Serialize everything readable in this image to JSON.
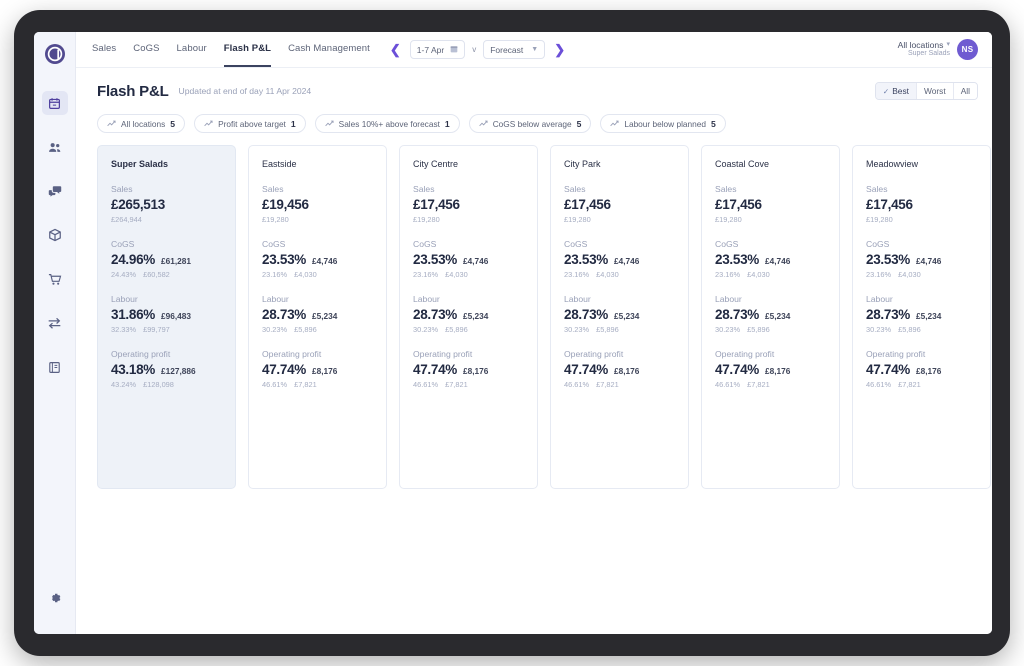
{
  "sidebar": {
    "logo_icon": "location-pin-logo",
    "items": [
      {
        "name": "calendar",
        "icon": "calendar-icon",
        "active": true
      },
      {
        "name": "people",
        "icon": "people-icon",
        "active": false
      },
      {
        "name": "chat",
        "icon": "chat-icon",
        "active": false
      },
      {
        "name": "inventory",
        "icon": "box-icon",
        "active": false
      },
      {
        "name": "orders",
        "icon": "cart-icon",
        "active": false
      },
      {
        "name": "transfers",
        "icon": "transfer-arrows-icon",
        "active": false
      },
      {
        "name": "reports",
        "icon": "book-icon",
        "active": false
      }
    ],
    "settings_icon": "gear-icon"
  },
  "topnav": {
    "tabs": [
      {
        "label": "Sales",
        "active": false
      },
      {
        "label": "CoGS",
        "active": false
      },
      {
        "label": "Labour",
        "active": false
      },
      {
        "label": "Flash P&L",
        "active": true
      },
      {
        "label": "Cash Management",
        "active": false
      }
    ],
    "prev_icon": "chevron-left-icon",
    "next_icon": "chevron-right-icon",
    "date_value": "1-7 Apr",
    "date_icon": "calendar-icon",
    "vs_label": "v",
    "compare_value": "Forecast",
    "location_label": "All locations",
    "company_label": "Super Salads",
    "avatar_initials": "NS"
  },
  "page": {
    "title": "Flash P&L",
    "subtitle": "Updated at end of day 11 Apr 2024",
    "segmented": [
      {
        "label": "Best",
        "selected": true
      },
      {
        "label": "Worst",
        "selected": false
      },
      {
        "label": "All",
        "selected": false
      }
    ]
  },
  "chips": [
    {
      "label": "All locations",
      "count": "5",
      "icon": "trend-icon"
    },
    {
      "label": "Profit above target",
      "count": "1",
      "icon": "trend-icon"
    },
    {
      "label": "Sales 10%+ above forecast",
      "count": "1",
      "icon": "trend-icon"
    },
    {
      "label": "CoGS below average",
      "count": "5",
      "icon": "trend-icon"
    },
    {
      "label": "Labour below planned",
      "count": "5",
      "icon": "trend-icon"
    }
  ],
  "metric_labels": {
    "sales": "Sales",
    "cogs": "CoGS",
    "labour": "Labour",
    "operating_profit": "Operating profit"
  },
  "cards": [
    {
      "name": "Super Salads",
      "highlighted": true,
      "sales": {
        "main": "£265,513",
        "prev": "£264,944"
      },
      "cogs": {
        "pct": "24.96%",
        "amt": "£61,281",
        "prev_pct": "24.43%",
        "prev_amt": "£60,582"
      },
      "labour": {
        "pct": "31.86%",
        "amt": "£96,483",
        "prev_pct": "32.33%",
        "prev_amt": "£99,797"
      },
      "op": {
        "pct": "43.18%",
        "amt": "£127,886",
        "prev_pct": "43.24%",
        "prev_amt": "£128,098"
      }
    },
    {
      "name": "Eastside",
      "highlighted": false,
      "sales": {
        "main": "£19,456",
        "prev": "£19,280"
      },
      "cogs": {
        "pct": "23.53%",
        "amt": "£4,746",
        "prev_pct": "23.16%",
        "prev_amt": "£4,030"
      },
      "labour": {
        "pct": "28.73%",
        "amt": "£5,234",
        "prev_pct": "30.23%",
        "prev_amt": "£5,896"
      },
      "op": {
        "pct": "47.74%",
        "amt": "£8,176",
        "prev_pct": "46.61%",
        "prev_amt": "£7,821"
      }
    },
    {
      "name": "City Centre",
      "highlighted": false,
      "sales": {
        "main": "£17,456",
        "prev": "£19,280"
      },
      "cogs": {
        "pct": "23.53%",
        "amt": "£4,746",
        "prev_pct": "23.16%",
        "prev_amt": "£4,030"
      },
      "labour": {
        "pct": "28.73%",
        "amt": "£5,234",
        "prev_pct": "30.23%",
        "prev_amt": "£5,896"
      },
      "op": {
        "pct": "47.74%",
        "amt": "£8,176",
        "prev_pct": "46.61%",
        "prev_amt": "£7,821"
      }
    },
    {
      "name": "City Park",
      "highlighted": false,
      "sales": {
        "main": "£17,456",
        "prev": "£19,280"
      },
      "cogs": {
        "pct": "23.53%",
        "amt": "£4,746",
        "prev_pct": "23.16%",
        "prev_amt": "£4,030"
      },
      "labour": {
        "pct": "28.73%",
        "amt": "£5,234",
        "prev_pct": "30.23%",
        "prev_amt": "£5,896"
      },
      "op": {
        "pct": "47.74%",
        "amt": "£8,176",
        "prev_pct": "46.61%",
        "prev_amt": "£7,821"
      }
    },
    {
      "name": "Coastal Cove",
      "highlighted": false,
      "sales": {
        "main": "£17,456",
        "prev": "£19,280"
      },
      "cogs": {
        "pct": "23.53%",
        "amt": "£4,746",
        "prev_pct": "23.16%",
        "prev_amt": "£4,030"
      },
      "labour": {
        "pct": "28.73%",
        "amt": "£5,234",
        "prev_pct": "30.23%",
        "prev_amt": "£5,896"
      },
      "op": {
        "pct": "47.74%",
        "amt": "£8,176",
        "prev_pct": "46.61%",
        "prev_amt": "£7,821"
      }
    },
    {
      "name": "Meadowview",
      "highlighted": false,
      "sales": {
        "main": "£17,456",
        "prev": "£19,280"
      },
      "cogs": {
        "pct": "23.53%",
        "amt": "£4,746",
        "prev_pct": "23.16%",
        "prev_amt": "£4,030"
      },
      "labour": {
        "pct": "28.73%",
        "amt": "£5,234",
        "prev_pct": "30.23%",
        "prev_amt": "£5,896"
      },
      "op": {
        "pct": "47.74%",
        "amt": "£8,176",
        "prev_pct": "46.61%",
        "prev_amt": "£7,821"
      }
    }
  ],
  "colors": {
    "accent": "#6b4fd8",
    "avatar": "#6f5bd1",
    "sidebar_bg": "#f3f5fb",
    "card_highlight": "#eef2f8",
    "text_dark": "#222a42",
    "text_muted": "#9aa1b8"
  }
}
